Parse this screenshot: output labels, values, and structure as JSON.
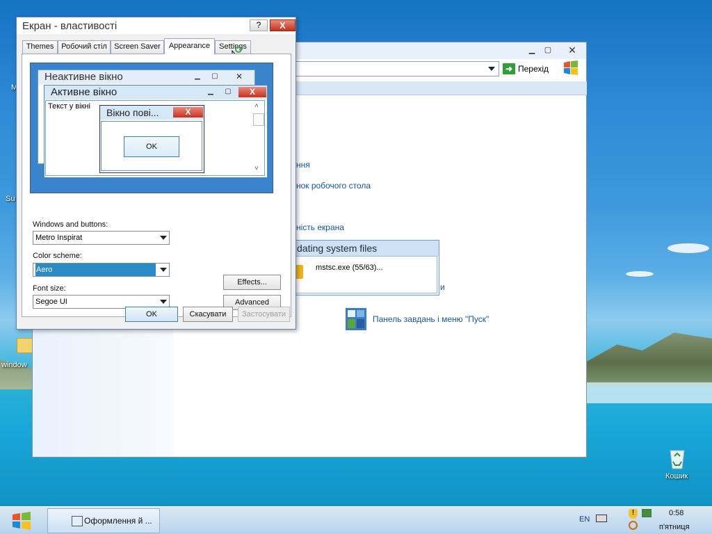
{
  "desktop": {
    "icon_windows_label": "window",
    "icon_left_m": "M",
    "icon_left_su": "Su",
    "recycle_label": "Кошик"
  },
  "bg_window": {
    "go_label": "Перехід",
    "links": [
      "ння",
      "нок робочого стола",
      "ність екрана",
      "и",
      "Панель завдань і меню \"Пуск\""
    ],
    "window_controls": [
      "minimize",
      "maximize",
      "close"
    ]
  },
  "progress_dialog": {
    "title": "dating system files",
    "file": "mstsc.exe (55/63)..."
  },
  "dialog": {
    "title": "Екран - властивості",
    "help": "?",
    "close": "X",
    "tabs": [
      "Themes",
      "Робочий стіл",
      "Screen Saver",
      "Appearance",
      "Settings"
    ],
    "selected_tab": "Appearance",
    "preview": {
      "inactive_title": "Неактивне вікно",
      "active_title": "Активне вікно",
      "window_text": "Текст у вікні",
      "msg_title": "Вікно пові...",
      "msg_ok": "OK"
    },
    "windows_buttons_label": "Windows and buttons:",
    "windows_buttons_value": "Metro Inspirat",
    "color_scheme_label": "Color scheme:",
    "color_scheme_value": "Aero",
    "font_size_label": "Font size:",
    "font_size_value": "Segoe UI",
    "effects_button": "Effects...",
    "advanced_button": "Advanced",
    "ok_button": "OK",
    "cancel_button": "Скасувати",
    "apply_button": "Застосувати"
  },
  "taskbar": {
    "task_label": "Оформлення й ...",
    "lang": "EN",
    "time": "0:58",
    "day": "п'ятниця"
  },
  "colors": {
    "title_close_red": "#c6311d",
    "selection_blue": "#2a8cc6",
    "preview_bg": "#3a84cb"
  }
}
